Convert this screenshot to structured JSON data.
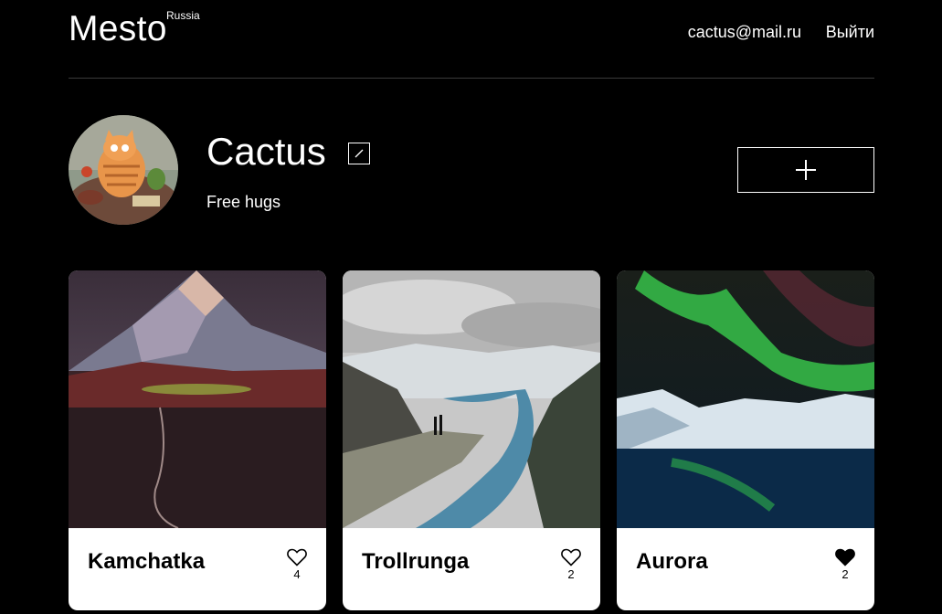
{
  "header": {
    "logo": "Mesto",
    "logo_sup": "Russia",
    "email": "cactus@mail.ru",
    "logout": "Выйти"
  },
  "profile": {
    "name": "Cactus",
    "about": "Free hugs"
  },
  "cards": [
    {
      "title": "Kamchatka",
      "likes": "4",
      "liked": false
    },
    {
      "title": "Trollrunga",
      "likes": "2",
      "liked": false
    },
    {
      "title": "Aurora",
      "likes": "2",
      "liked": true
    }
  ]
}
